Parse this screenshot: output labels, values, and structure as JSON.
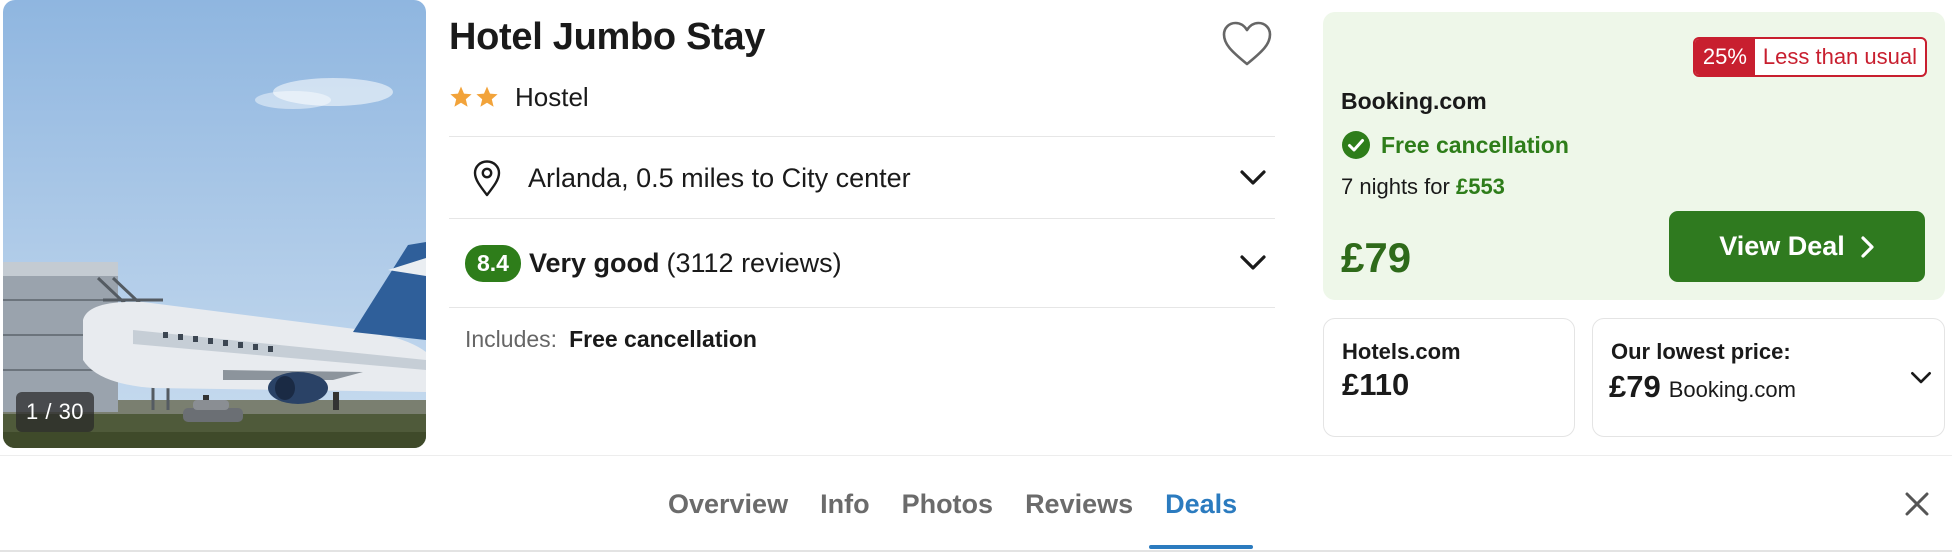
{
  "photo": {
    "counter": "1 / 30"
  },
  "hotel": {
    "name": "Hotel Jumbo Stay",
    "star_count": 2,
    "type": "Hostel",
    "location": "Arlanda, 0.5 miles to City center",
    "rating": {
      "score": "8.4",
      "word": "Very good",
      "reviews": "(3112 reviews)"
    },
    "includes_label": "Includes:",
    "includes_value": "Free cancellation"
  },
  "deal": {
    "discount_pct": "25%",
    "discount_text": "Less than usual",
    "provider": "Booking.com",
    "free_cancel": "Free cancellation",
    "nights_text": "7 nights for",
    "nights_total": "£553",
    "price": "£79",
    "button": "View Deal"
  },
  "alt_deals": [
    {
      "provider": "Hotels.com",
      "price": "£110"
    },
    {
      "label": "Our lowest price:",
      "price": "£79",
      "provider": "Booking.com"
    }
  ],
  "tabs": [
    {
      "label": "Overview",
      "active": false
    },
    {
      "label": "Info",
      "active": false
    },
    {
      "label": "Photos",
      "active": false
    },
    {
      "label": "Reviews",
      "active": false
    },
    {
      "label": "Deals",
      "active": true
    }
  ],
  "colors": {
    "accent_green": "#2e7d1a",
    "deal_bg": "#eef7e9",
    "discount_red": "#c81f2f",
    "tab_active_blue": "#2b7bbf",
    "star_orange": "#f2a33a"
  },
  "icons": [
    "heart-icon",
    "star-icon",
    "map-pin-icon",
    "chevron-down-icon",
    "check-circle-icon",
    "chevron-right-icon",
    "close-icon"
  ]
}
